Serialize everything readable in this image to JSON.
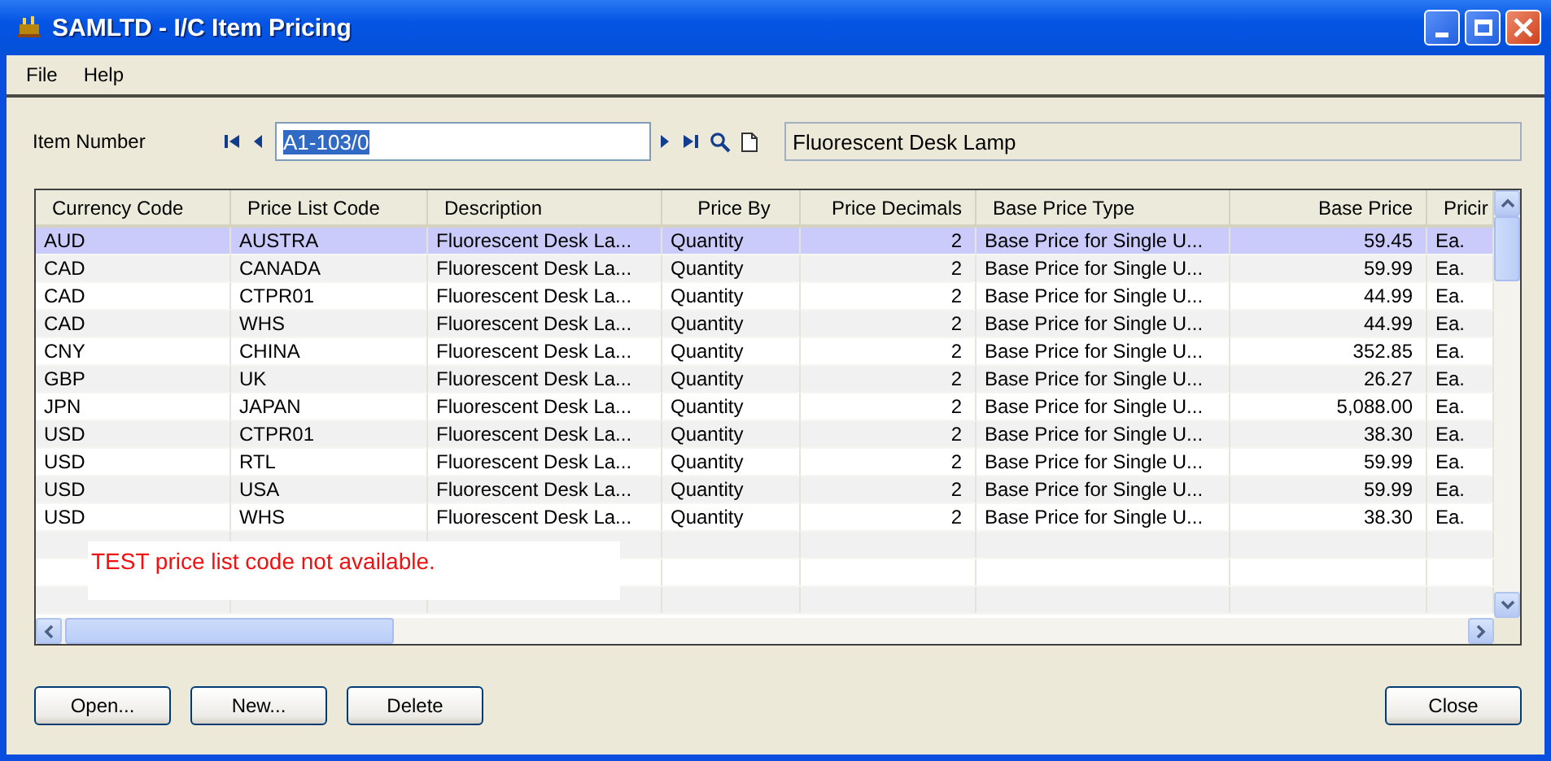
{
  "window": {
    "title": "SAMLTD - I/C Item Pricing"
  },
  "menu": [
    "File",
    "Help"
  ],
  "item": {
    "label": "Item Number",
    "value": "A1-103/0",
    "value_selected": true,
    "description": "Fluorescent Desk Lamp"
  },
  "table": {
    "columns": [
      "Currency Code",
      "Price List Code",
      "Description",
      "Price By",
      "Price Decimals",
      "Base Price Type",
      "Base Price",
      "Pricir"
    ],
    "rows": [
      {
        "selected": true,
        "cells": [
          "AUD",
          "AUSTRA",
          "Fluorescent Desk La...",
          "Quantity",
          "2",
          "Base Price for Single U...",
          "59.45",
          "Ea."
        ]
      },
      {
        "selected": false,
        "cells": [
          "CAD",
          "CANADA",
          "Fluorescent Desk La...",
          "Quantity",
          "2",
          "Base Price for Single U...",
          "59.99",
          "Ea."
        ]
      },
      {
        "selected": false,
        "cells": [
          "CAD",
          "CTPR01",
          "Fluorescent Desk La...",
          "Quantity",
          "2",
          "Base Price for Single U...",
          "44.99",
          "Ea."
        ]
      },
      {
        "selected": false,
        "cells": [
          "CAD",
          "WHS",
          "Fluorescent Desk La...",
          "Quantity",
          "2",
          "Base Price for Single U...",
          "44.99",
          "Ea."
        ]
      },
      {
        "selected": false,
        "cells": [
          "CNY",
          "CHINA",
          "Fluorescent Desk La...",
          "Quantity",
          "2",
          "Base Price for Single U...",
          "352.85",
          "Ea."
        ]
      },
      {
        "selected": false,
        "cells": [
          "GBP",
          "UK",
          "Fluorescent Desk La...",
          "Quantity",
          "2",
          "Base Price for Single U...",
          "26.27",
          "Ea."
        ]
      },
      {
        "selected": false,
        "cells": [
          "JPN",
          "JAPAN",
          "Fluorescent Desk La...",
          "Quantity",
          "2",
          "Base Price for Single U...",
          "5,088.00",
          "Ea."
        ]
      },
      {
        "selected": false,
        "cells": [
          "USD",
          "CTPR01",
          "Fluorescent Desk La...",
          "Quantity",
          "2",
          "Base Price for Single U...",
          "38.30",
          "Ea."
        ]
      },
      {
        "selected": false,
        "cells": [
          "USD",
          "RTL",
          "Fluorescent Desk La...",
          "Quantity",
          "2",
          "Base Price for Single U...",
          "59.99",
          "Ea."
        ]
      },
      {
        "selected": false,
        "cells": [
          "USD",
          "USA",
          "Fluorescent Desk La...",
          "Quantity",
          "2",
          "Base Price for Single U...",
          "59.99",
          "Ea."
        ]
      },
      {
        "selected": false,
        "cells": [
          "USD",
          "WHS",
          "Fluorescent Desk La...",
          "Quantity",
          "2",
          "Base Price for Single U...",
          "38.30",
          "Ea."
        ]
      }
    ]
  },
  "message": "TEST price list code not available.",
  "buttons_left": [
    "Open...",
    "New...",
    "Delete"
  ],
  "buttons_right": [
    "Close"
  ]
}
